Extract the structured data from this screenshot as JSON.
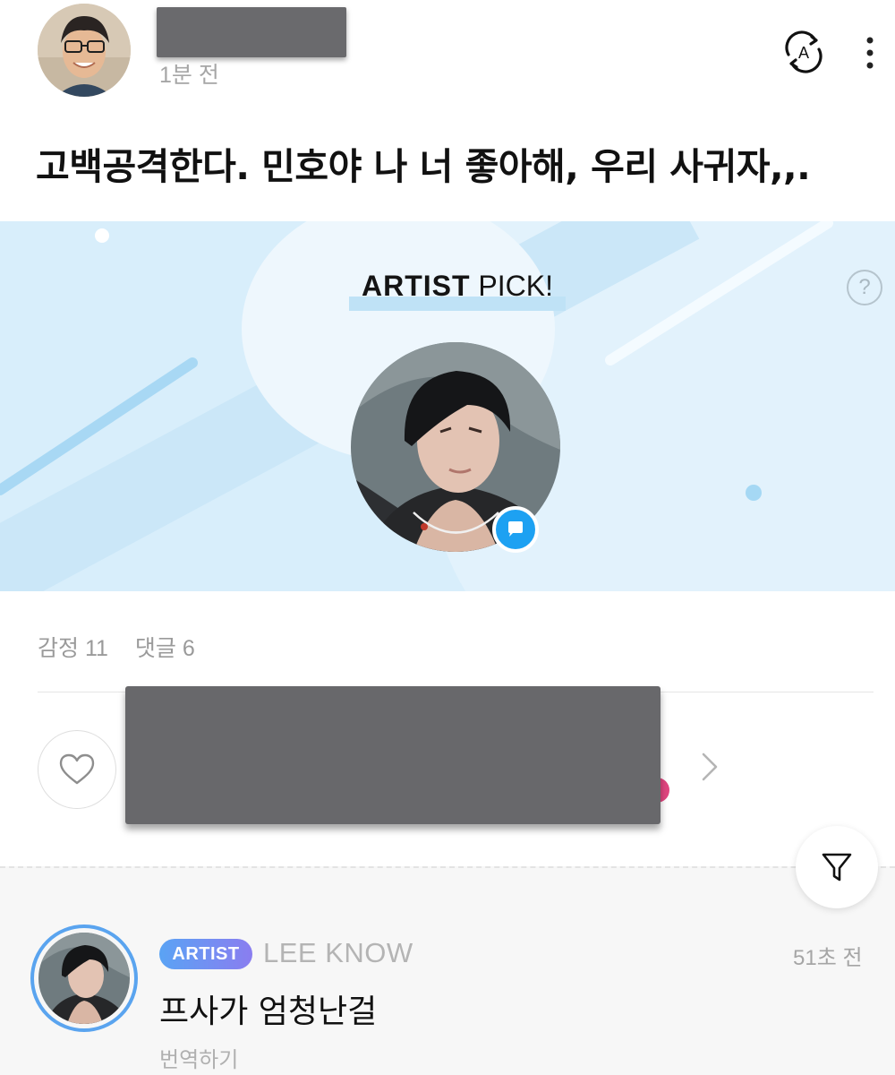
{
  "post": {
    "time": "1분 전",
    "text": "고백공격한다. 민호야 나 너 좋아해, 우리 사귀자,,."
  },
  "artist_pick": {
    "title_bold": "ARTIST",
    "title_rest": " PICK!",
    "help": "?"
  },
  "stats": {
    "emotions": "감정 11",
    "comments": "댓글 6"
  },
  "comment": {
    "badge": "ARTIST",
    "author": "LEE KNOW",
    "time": "51초 전",
    "text": "프사가 엄청난걸",
    "translate": "번역하기"
  },
  "colors": {
    "banner_bg": "#d8eefb",
    "accent_blue": "#1da1f2",
    "badge_gradient_start": "#5aa3f4",
    "badge_gradient_end": "#8a7df0",
    "pink": "#e0457f"
  },
  "icons": {
    "translate": "translate-a-icon",
    "more": "more-vertical-icon",
    "help": "question-circle-icon",
    "comment": "speech-bubble-icon",
    "heart": "heart-outline-icon",
    "chevron": "chevron-right-icon",
    "filter": "filter-funnel-icon"
  }
}
